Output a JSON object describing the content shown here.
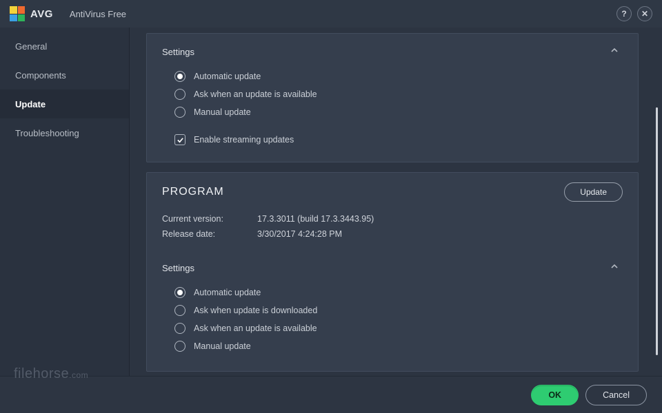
{
  "header": {
    "brand": "AVG",
    "title": "AntiVirus Free",
    "help_symbol": "?",
    "close_symbol": "✕",
    "logo_colors": [
      "#f3d33a",
      "#f06a2f",
      "#3aa0e3",
      "#2fb45a"
    ]
  },
  "sidebar": {
    "items": [
      {
        "label": "General",
        "active": false
      },
      {
        "label": "Components",
        "active": false
      },
      {
        "label": "Update",
        "active": true
      },
      {
        "label": "Troubleshooting",
        "active": false
      }
    ]
  },
  "panel1": {
    "title": "Settings",
    "options": [
      {
        "label": "Automatic update",
        "checked": true
      },
      {
        "label": "Ask when an update is available",
        "checked": false
      },
      {
        "label": "Manual update",
        "checked": false
      }
    ],
    "checkbox": {
      "label": "Enable streaming updates",
      "checked": true
    }
  },
  "program": {
    "heading": "PROGRAM",
    "update_label": "Update",
    "info": {
      "version_label": "Current version:",
      "version_value": "17.3.3011 (build 17.3.3443.95)",
      "release_label": "Release date:",
      "release_value": "3/30/2017 4:24:28 PM"
    },
    "settings_title": "Settings",
    "options": [
      {
        "label": "Automatic update",
        "checked": true
      },
      {
        "label": "Ask when update is downloaded",
        "checked": false
      },
      {
        "label": "Ask when an update is available",
        "checked": false
      },
      {
        "label": "Manual update",
        "checked": false
      }
    ]
  },
  "footer": {
    "ok_label": "OK",
    "cancel_label": "Cancel"
  },
  "watermark": {
    "name": "filehorse",
    "suffix": ".com"
  }
}
